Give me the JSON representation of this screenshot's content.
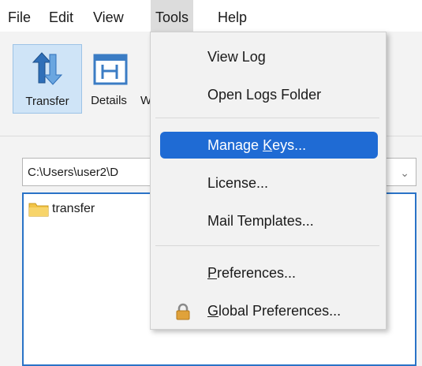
{
  "menubar": {
    "file": "File",
    "edit": "Edit",
    "view": "View",
    "tools": "Tools",
    "help": "Help"
  },
  "toolbar": {
    "transfer_label": "Transfer",
    "details_label": "Details",
    "next_label_partial": "W"
  },
  "path": {
    "value": "C:\\Users\\user2\\D",
    "chevron": "⌄"
  },
  "file_list": {
    "items": [
      {
        "name": "transfer",
        "icon": "folder-icon"
      }
    ]
  },
  "tools_menu": {
    "items": [
      {
        "label": "View Log"
      },
      {
        "label": "Open Logs Folder"
      },
      {
        "label_pre": "Manage ",
        "label_u": "K",
        "label_post": "eys...",
        "highlighted": true
      },
      {
        "label": "License..."
      },
      {
        "label": "Mail Templates..."
      },
      {
        "label_u": "P",
        "label_post": "references..."
      },
      {
        "label_u": "G",
        "label_post": "lobal Preferences...",
        "icon": "lock-icon"
      }
    ]
  },
  "colors": {
    "highlight": "#1f6bd4",
    "selected_tool": "#cfe4f7",
    "list_border": "#2a73c7"
  }
}
